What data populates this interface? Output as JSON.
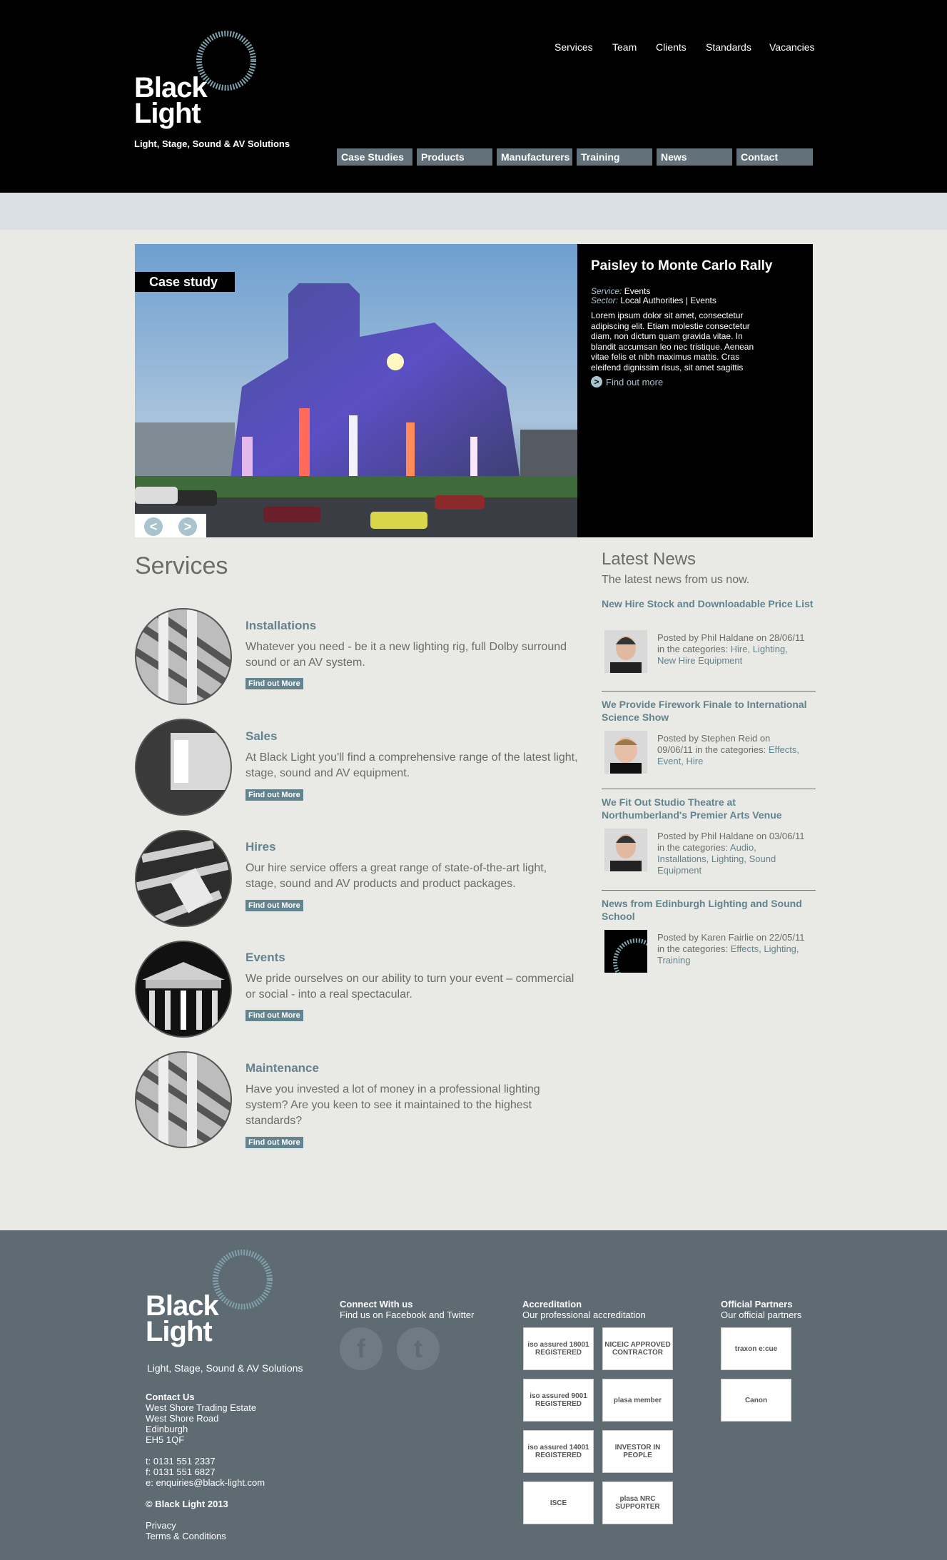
{
  "header": {
    "logo_line1": "Black",
    "logo_line2": "Light",
    "tagline": "Light, Stage, Sound & AV Solutions",
    "top_nav": [
      "Services",
      "Team",
      "Clients",
      "Standards",
      "Vacancies"
    ],
    "sub_nav": [
      "Case Studies",
      "Products",
      "Manufacturers",
      "Training",
      "News",
      "Contact"
    ]
  },
  "slider": {
    "label": "Case study",
    "title": "Paisley to Monte Carlo Rally",
    "service_label": "Service:",
    "service_value": "Events",
    "sector_label": "Sector:",
    "sector_value": "Local Authorities | Events",
    "body": "Lorem ipsum dolor sit amet, consectetur adipiscing elit. Etiam molestie consectetur diam, non dictum quam gravida vitae. In blandit accumsan leo nec tristique. Aenean vitae felis et nibh maximus mattis. Cras eleifend dignissim risus, sit amet sagittis",
    "find_out_more": "Find out more",
    "prev": "<",
    "next": ">"
  },
  "services": {
    "heading": "Services",
    "items": [
      {
        "title": "Installations",
        "text": "Whatever you need - be it a new lighting rig, full Dolby surround sound or an AV system.",
        "button": "Find out More"
      },
      {
        "title": "Sales",
        "text": "At Black Light you'll find a comprehensive range of the latest light, stage, sound and AV equipment.",
        "button": "Find out More"
      },
      {
        "title": "Hires",
        "text": "Our hire service offers a great range of state-of-the-art light, stage, sound and AV products and product packages.",
        "button": "Find out More"
      },
      {
        "title": "Events",
        "text": "We pride ourselves on our ability to turn your event – commercial or social - into a real spectacular.",
        "button": "Find out More"
      },
      {
        "title": "Maintenance",
        "text": "Have you invested a lot of money in a professional lighting system? Are you keen to see it maintained to the highest standards?",
        "button": "Find out More"
      }
    ]
  },
  "news": {
    "heading": "Latest News",
    "subheading": "The latest news from us now.",
    "items": [
      {
        "title": "New Hire Stock and Downloadable Price List",
        "meta": "Posted by Phil Haldane on 28/06/11 in the categories:",
        "cats": "Hire, Lighting, New Hire Equipment"
      },
      {
        "title": "We Provide Firework Finale to International Science Show",
        "meta": "Posted by Stephen Reid on 09/06/11 in the categories:",
        "cats": "Effects, Event, Hire"
      },
      {
        "title": "We Fit Out Studio Theatre at Northumberland's Premier Arts Venue",
        "meta": "Posted by Phil Haldane on 03/06/11 in the categories:",
        "cats": "Audio, Installations, Lighting, Sound Equipment"
      },
      {
        "title": "News from Edinburgh Lighting and Sound School",
        "meta": "Posted by Karen Fairlie on 22/05/11 in the categories:",
        "cats": "Effects, Lighting, Training"
      }
    ]
  },
  "footer": {
    "logo_line1": "Black",
    "logo_line2": "Light",
    "tagline": "Light, Stage, Sound & AV Solutions",
    "contact_heading": "Contact Us",
    "address": [
      "West Shore Trading Estate",
      "West Shore Road",
      "Edinburgh",
      "EH5 1QF"
    ],
    "phone": "t: 0131 551 2337",
    "fax": "f: 0131 551 6827",
    "email": "e: enquiries@black-light.com",
    "copyright": "© Black Light 2013",
    "privacy": "Privacy",
    "terms": "Terms & Conditions",
    "connect_heading": "Connect With us",
    "connect_sub": "Find us on Facebook and Twitter",
    "facebook": "f",
    "twitter": "t",
    "accred_heading": "Accreditation",
    "accred_sub": "Our professional accreditation",
    "accred_badges": [
      "iso assured 18001 REGISTERED",
      "NICEIC APPROVED CONTRACTOR",
      "iso assured 9001 REGISTERED",
      "plasa member",
      "iso assured 14001 REGISTERED",
      "INVESTOR IN PEOPLE",
      "ISCE",
      "plasa NRC SUPPORTER"
    ],
    "partners_heading": "Official Partners",
    "partners_sub": "Our official partners",
    "partner_badges": [
      "traxon e:cue",
      "Canon"
    ]
  },
  "colors": {
    "accent": "#63838f",
    "footer_bg": "#5f6b73",
    "nav_bg": "#63717a",
    "band": "#d9dfe2"
  }
}
